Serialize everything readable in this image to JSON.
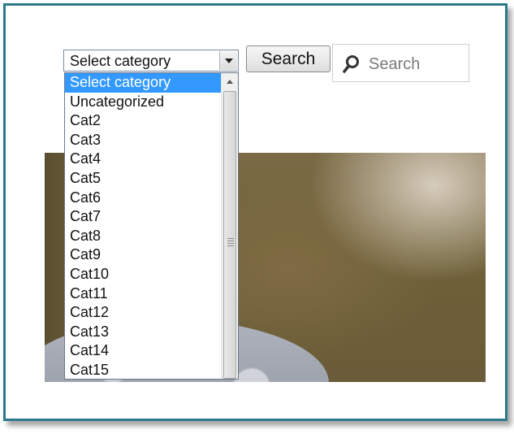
{
  "category_select": {
    "selected": "Select category",
    "options": [
      "Select category",
      "Uncategorized",
      "Cat2",
      "Cat3",
      "Cat4",
      "Cat5",
      "Cat6",
      "Cat7",
      "Cat8",
      "Cat9",
      "Cat10",
      "Cat11",
      "Cat12",
      "Cat13",
      "Cat14",
      "Cat15"
    ]
  },
  "search_button": {
    "label": "Search"
  },
  "search_field": {
    "placeholder": "Search"
  },
  "colors": {
    "frame": "#2a7a8c",
    "highlight": "#3399ff"
  }
}
